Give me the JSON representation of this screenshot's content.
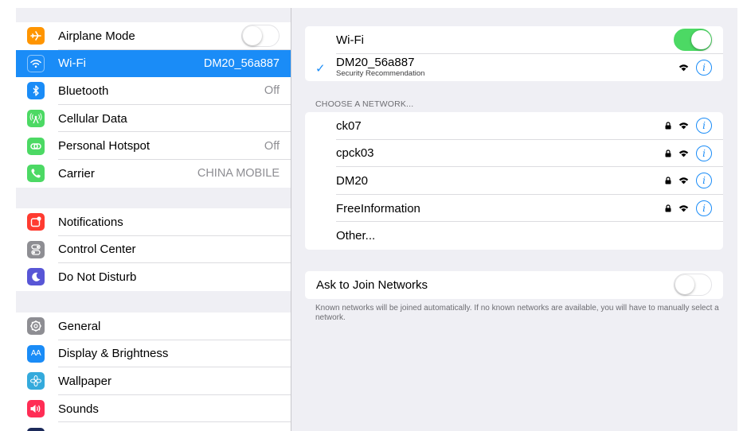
{
  "sidebar": {
    "group1": [
      {
        "label": "Airplane Mode",
        "value": "",
        "toggle": "off",
        "icon": "airplane-icon",
        "color": "#ff9500"
      },
      {
        "label": "Wi-Fi",
        "value": "DM20_56a887",
        "icon": "wifi-icon",
        "color": "#1a8cf7",
        "selected": true
      },
      {
        "label": "Bluetooth",
        "value": "Off",
        "icon": "bluetooth-icon",
        "color": "#1a8cf7"
      },
      {
        "label": "Cellular Data",
        "value": "",
        "icon": "antenna-icon",
        "color": "#4cd964"
      },
      {
        "label": "Personal Hotspot",
        "value": "Off",
        "icon": "hotspot-icon",
        "color": "#4cd964"
      },
      {
        "label": "Carrier",
        "value": "CHINA MOBILE",
        "icon": "phone-icon",
        "color": "#4cd964"
      }
    ],
    "group2": [
      {
        "label": "Notifications",
        "icon": "notifications-icon",
        "color": "#ff3b30"
      },
      {
        "label": "Control Center",
        "icon": "control-center-icon",
        "color": "#8e8e93"
      },
      {
        "label": "Do Not Disturb",
        "icon": "moon-icon",
        "color": "#5856d6"
      }
    ],
    "group3": [
      {
        "label": "General",
        "icon": "gear-icon",
        "color": "#8e8e93"
      },
      {
        "label": "Display & Brightness",
        "icon": "display-icon",
        "color": "#1a8cf7",
        "icon_text": "AA"
      },
      {
        "label": "Wallpaper",
        "icon": "wallpaper-icon",
        "color": "#34aadc"
      },
      {
        "label": "Sounds",
        "icon": "speaker-icon",
        "color": "#ff2d55"
      }
    ]
  },
  "detail": {
    "wifi": {
      "label": "Wi-Fi",
      "toggle": "on"
    },
    "connected": {
      "name": "DM20_56a887",
      "subtitle": "Security Recommendation"
    },
    "choose_header": "CHOOSE A NETWORK...",
    "networks": [
      {
        "name": "ck07",
        "locked": true
      },
      {
        "name": "cpck03",
        "locked": true
      },
      {
        "name": "DM20",
        "locked": true
      },
      {
        "name": "FreeInformation",
        "locked": true
      }
    ],
    "other_label": "Other...",
    "ask": {
      "label": "Ask to Join Networks",
      "toggle": "off"
    },
    "ask_footnote": "Known networks will be joined automatically. If no known networks are available, you will have to manually select a network."
  },
  "colors": {
    "accent": "#1a8cf7",
    "toggle_on": "#4cd964",
    "background": "#efeff4"
  }
}
